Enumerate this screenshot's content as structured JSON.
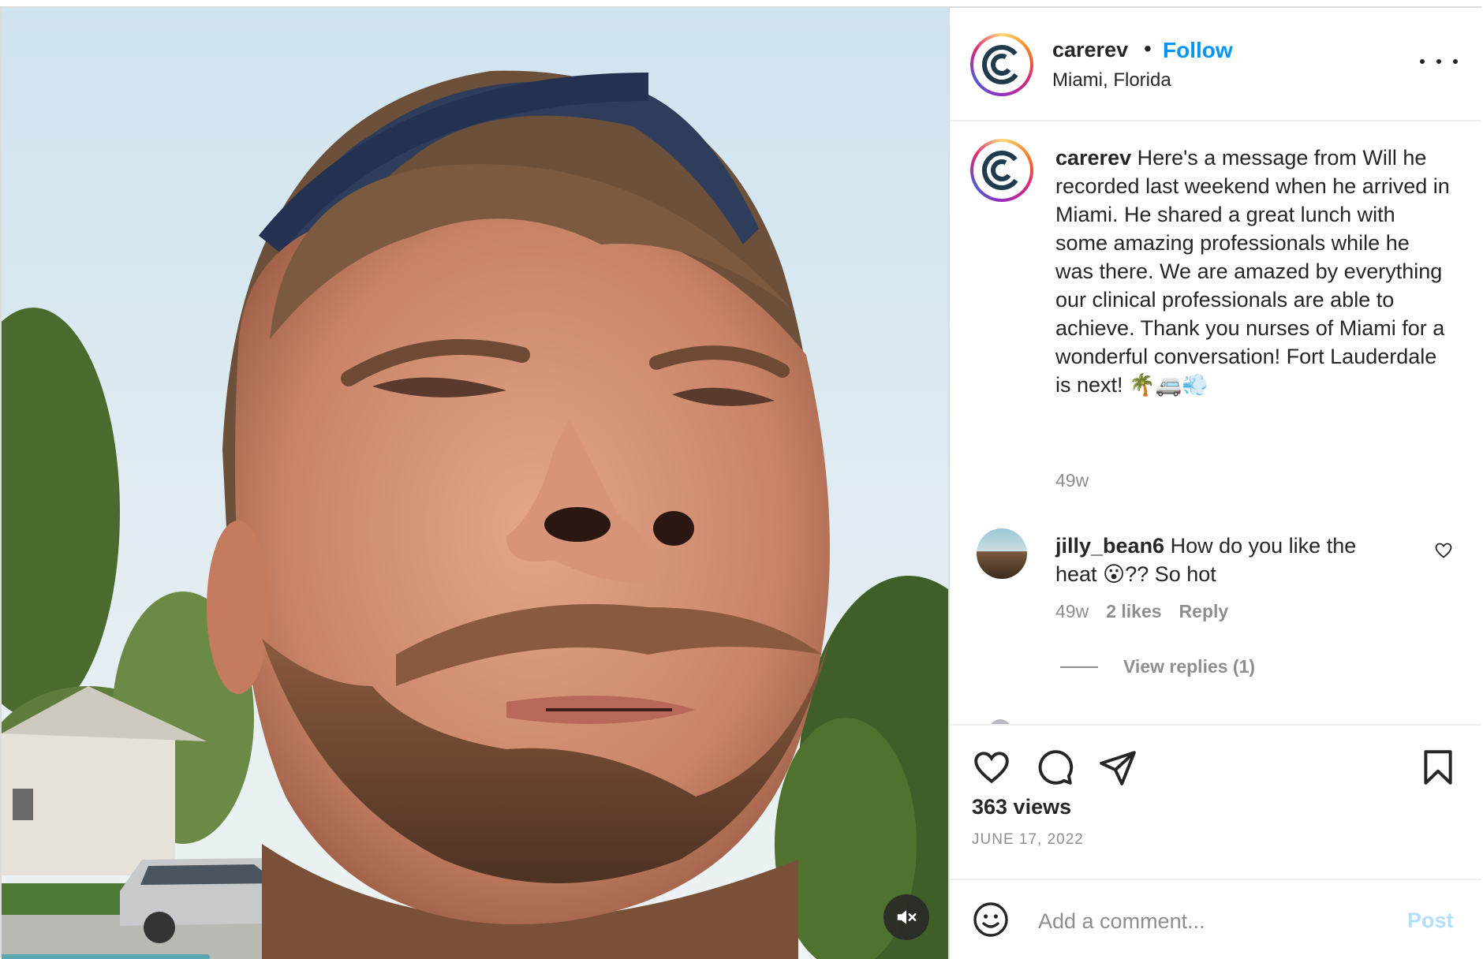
{
  "header": {
    "username": "carerev",
    "separator": "•",
    "follow_label": "Follow",
    "location": "Miami, Florida"
  },
  "caption": {
    "username": "carerev",
    "text": "Here's a message from Will he recorded last weekend when he arrived in Miami. He shared a great lunch with some amazing professionals while he was there. We are amazed by everything our clinical professionals are able to achieve. Thank you nurses of Miami for a wonderful conversation! Fort Lauderdale is next! 🌴🚐💨",
    "time": "49w"
  },
  "comments": [
    {
      "username": "jilly_bean6",
      "text": "How do you like the heat 😮?? So hot",
      "time": "49w",
      "likes": "2 likes",
      "reply_label": "Reply",
      "view_replies": "View replies (1)"
    }
  ],
  "stats": {
    "views": "363 views",
    "date": "JUNE 17, 2022"
  },
  "add_comment": {
    "placeholder": "Add a comment...",
    "post_label": "Post"
  },
  "icons": {
    "like": "heart-icon",
    "comment": "comment-bubble-icon",
    "share": "paper-plane-icon",
    "save": "bookmark-icon",
    "emoji": "smiley-icon",
    "mute": "speaker-muted-icon",
    "more": "more-options-icon"
  },
  "colors": {
    "accent": "#0095f6",
    "post_disabled": "#b2dffc",
    "secondary_text": "#8e8e8e"
  }
}
